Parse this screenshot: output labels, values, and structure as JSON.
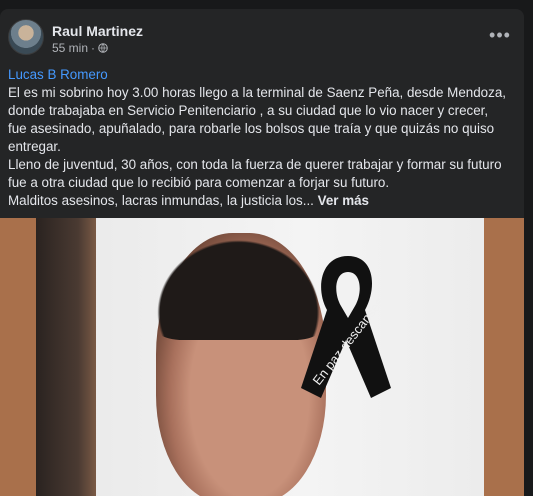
{
  "post": {
    "author": "Raul Martinez",
    "time": "55 min",
    "separator": "·",
    "tag": "Lucas B Romero",
    "text": [
      "El es mi sobrino  hoy 3.00 horas llego a la terminal de Saenz Peña, desde Mendoza,",
      "donde trabajaba en Servicio Penitenciario ,  a su ciudad que lo vio nacer y crecer,",
      "fue asesinado, apuñalado, para robarle los bolsos que traía y que quizás no  quiso",
      "entregar.",
      "Lleno de juventud, 30 años, con toda la fuerza de querer trabajar y formar su futuro",
      "fue a otra ciudad que lo recibió para comenzar a forjar su futuro."
    ],
    "last_line": "Malditos asesinos, lacras inmundas, la justicia los...",
    "see_more": "Ver más",
    "ribbon_text": "En paz descanses"
  },
  "icons": {
    "globe": "globe-icon",
    "more": "more-options-icon"
  },
  "colors": {
    "background": "#18191a",
    "card": "#242526",
    "link": "#4599ff",
    "text": "#e4e6eb",
    "secondary": "#b0b3b8"
  }
}
